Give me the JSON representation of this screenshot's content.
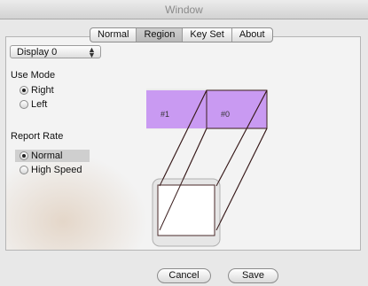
{
  "window": {
    "title": "Window"
  },
  "tabs": [
    {
      "label": "Normal",
      "active": false
    },
    {
      "label": "Region",
      "active": true
    },
    {
      "label": "Key Set",
      "active": false
    },
    {
      "label": "About",
      "active": false
    }
  ],
  "display_select": {
    "value": "Display 0"
  },
  "use_mode": {
    "label": "Use Mode",
    "options": [
      {
        "label": "Right",
        "selected": true
      },
      {
        "label": "Left",
        "selected": false
      }
    ]
  },
  "report_rate": {
    "label": "Report Rate",
    "options": [
      {
        "label": "Normal",
        "selected": true
      },
      {
        "label": "High Speed",
        "selected": false
      }
    ]
  },
  "regions": [
    {
      "label": "#1",
      "color": "#c99af2"
    },
    {
      "label": "#0",
      "color": "#c99af2"
    }
  ],
  "buttons": {
    "cancel": "Cancel",
    "save": "Save"
  }
}
